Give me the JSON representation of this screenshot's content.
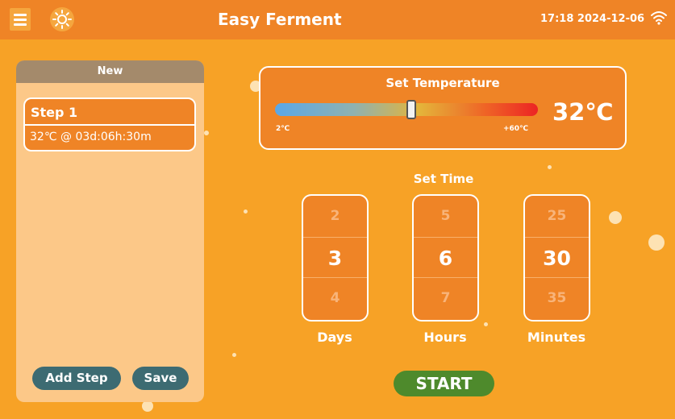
{
  "header": {
    "title": "Easy Ferment",
    "clock": "17:18 2024-12-06",
    "menu_icon": "hamburger-menu-icon",
    "theme_icon": "sun-icon",
    "wifi_icon": "wifi-icon"
  },
  "program": {
    "header": "New",
    "steps": [
      {
        "title": "Step 1",
        "detail": "32℃ @ 03d:06h:30m"
      }
    ],
    "add_step_label": "Add Step",
    "save_label": "Save"
  },
  "temperature": {
    "title": "Set Temperature",
    "min_label": "2℃",
    "max_label": "+60℃",
    "value": 32,
    "value_label": "32℃"
  },
  "time": {
    "title": "Set Time",
    "days": {
      "label": "Days",
      "prev": "2",
      "current": "3",
      "next": "4"
    },
    "hours": {
      "label": "Hours",
      "prev": "5",
      "current": "6",
      "next": "7"
    },
    "minutes": {
      "label": "Minutes",
      "prev": "25",
      "current": "30",
      "next": "35"
    }
  },
  "start_label": "START",
  "colors": {
    "background": "#f7a226",
    "header": "#ef8426",
    "panel": "#fcc888",
    "action_button": "#3d6b72",
    "start_button": "#4e8a2c"
  }
}
